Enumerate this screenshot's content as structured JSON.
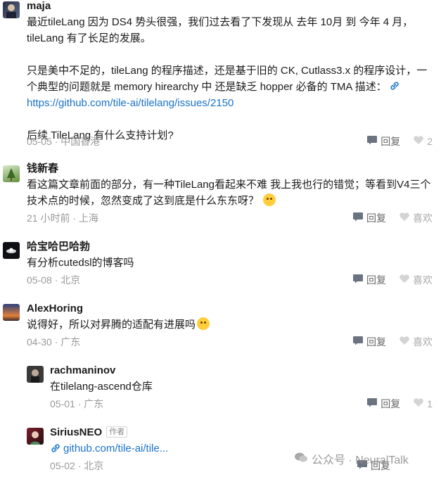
{
  "comments": [
    {
      "author": "maja",
      "para1": "最近tileLang 因为 DS4 势头很强，我们过去看了下发现从 去年 10月 到 今年 4 月，tileLang 有了长足的发展。",
      "para2_text": "只是美中不足的，tileLang 的程序描述，还是基于旧的 CK, Cutlass3.x 的程序设计，一个典型的问题就是 memory hirearchy 中 还是缺乏 hopper 必备的 TMA 描述：",
      "para2_link": "https://github.com/tile-ai/tilelang/issues/2150",
      "para3": "后续 TileLang 有什么支持计划?",
      "time": "05-05 · 中国香港",
      "reply_label": "回复",
      "like_label": "2"
    },
    {
      "author": "钱新春",
      "text": "看这篇文章前面的部分，有一种TileLang看起来不难 我上我也行的错觉；等看到V4三个技术点的时候，忽然变成了这到底是什么东东呀？",
      "time": "21 小时前 · 上海",
      "reply_label": "回复",
      "like_label": "喜欢"
    },
    {
      "author": "哈宝哈巴哈勃",
      "text": "有分析cutedsl的博客吗",
      "time": "05-08 · 北京",
      "reply_label": "回复",
      "like_label": "喜欢"
    },
    {
      "author": "AlexHoring",
      "text": "说得好，所以对昇腾的适配有进展吗",
      "time": "04-30 · 广东",
      "reply_label": "回复",
      "like_label": "喜欢"
    },
    {
      "author": "rachmaninov",
      "text": "在tilelang-ascend仓库",
      "time": "05-01 · 广东",
      "reply_label": "回复",
      "like_label": "1"
    },
    {
      "author": "SiriusNEO",
      "author_tag": "作者",
      "link": "github.com/tile-ai/tile...",
      "time": "05-02 · 北京",
      "reply_label": "回复"
    }
  ],
  "watermark": "公众号 · NeuralTalk",
  "colors": {
    "link": "#1a73c9",
    "meta": "#999999",
    "action": "#666666"
  }
}
